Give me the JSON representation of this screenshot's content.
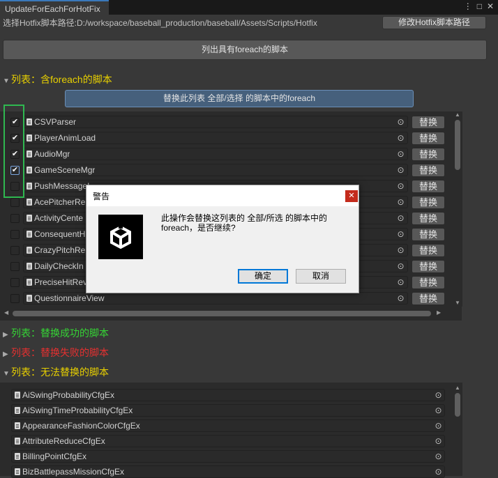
{
  "window": {
    "tab_title": "UpdateForEachForHotFix"
  },
  "toolbar": {
    "path_label": "选择Hotfix脚本路径:D:/workspace/baseball_production/baseball/Assets/Scripts/Hotfix",
    "modify_path_button": "修改Hotfix脚本路径",
    "list_foreach_button": "列出具有foreach的脚本"
  },
  "section_foreach": {
    "title": "列表：含foreach的脚本",
    "replace_all_button": "替换此列表 全部/选择 的脚本中的foreach",
    "items": [
      {
        "name": "CSVParser",
        "checked": true
      },
      {
        "name": "PlayerAnimLoad",
        "checked": true
      },
      {
        "name": "AudioMgr",
        "checked": true
      },
      {
        "name": "GameSceneMgr",
        "checked": true
      },
      {
        "name": "PushMessageI",
        "checked": false
      },
      {
        "name": "AcePitcherRe",
        "checked": false
      },
      {
        "name": "ActivityCente",
        "checked": false
      },
      {
        "name": "ConsequentH",
        "checked": false
      },
      {
        "name": "CrazyPitchRe",
        "checked": false
      },
      {
        "name": "DailyCheckIn",
        "checked": false
      },
      {
        "name": "PreciseHitRev",
        "checked": false
      },
      {
        "name": "QuestionnaireView",
        "checked": false
      }
    ],
    "replace_label": "替换"
  },
  "section_success": {
    "title": "列表：替换成功的脚本",
    "color": "#35d435"
  },
  "section_fail": {
    "title": "列表：替换失败的脚本",
    "color": "#e53030"
  },
  "section_unable": {
    "title": "列表：无法替换的脚本",
    "items": [
      "AiSwingProbabilityCfgEx",
      "AiSwingTimeProbabilityCfgEx",
      "AppearanceFashionColorCfgEx",
      "AttributeReduceCfgEx",
      "BillingPointCfgEx",
      "BizBattlepassMissionCfgEx"
    ]
  },
  "dialog": {
    "title": "警告",
    "message": "此操作会替换这列表的 全部/所选 的脚本中的foreach，是否继续?",
    "ok_button": "确定",
    "cancel_button": "取消",
    "logo": "unity-logo"
  },
  "colors": {
    "yellow_header": "#e8d000",
    "accent_button": "#46607c"
  }
}
